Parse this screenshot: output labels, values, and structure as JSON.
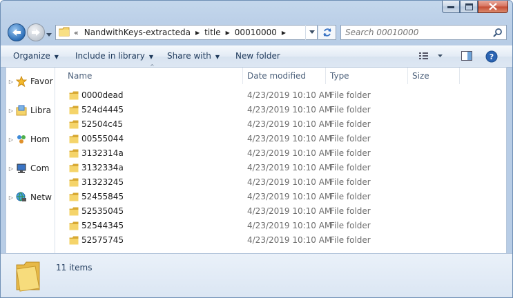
{
  "window": {
    "caption_buttons": [
      "minimize",
      "maximize",
      "close"
    ]
  },
  "address": {
    "overflow": "«",
    "crumbs": [
      "NandwithKeys-extracteda",
      "title",
      "00010000"
    ]
  },
  "search": {
    "placeholder": "Search 00010000"
  },
  "toolbar": {
    "organize": "Organize",
    "include": "Include in library",
    "share": "Share with",
    "new_folder": "New folder"
  },
  "nav": {
    "favorites": "Favor",
    "libraries": "Libra",
    "homegroup": "Hom",
    "computer": "Com",
    "network": "Netw"
  },
  "columns": {
    "name": "Name",
    "date": "Date modified",
    "type": "Type",
    "size": "Size"
  },
  "files": [
    {
      "name": "0000dead",
      "date": "4/23/2019 10:10 AM",
      "type": "File folder"
    },
    {
      "name": "524d4445",
      "date": "4/23/2019 10:10 AM",
      "type": "File folder"
    },
    {
      "name": "52504c45",
      "date": "4/23/2019 10:10 AM",
      "type": "File folder"
    },
    {
      "name": "00555044",
      "date": "4/23/2019 10:10 AM",
      "type": "File folder"
    },
    {
      "name": "3132314a",
      "date": "4/23/2019 10:10 AM",
      "type": "File folder"
    },
    {
      "name": "3132334a",
      "date": "4/23/2019 10:10 AM",
      "type": "File folder"
    },
    {
      "name": "31323245",
      "date": "4/23/2019 10:10 AM",
      "type": "File folder"
    },
    {
      "name": "52455845",
      "date": "4/23/2019 10:10 AM",
      "type": "File folder"
    },
    {
      "name": "52535045",
      "date": "4/23/2019 10:10 AM",
      "type": "File folder"
    },
    {
      "name": "52544345",
      "date": "4/23/2019 10:10 AM",
      "type": "File folder"
    },
    {
      "name": "52575745",
      "date": "4/23/2019 10:10 AM",
      "type": "File folder"
    }
  ],
  "details": {
    "count": "11 items"
  },
  "colors": {
    "folder": "#f5d46a",
    "folder_dark": "#d8a933",
    "accent": "#1e395b"
  }
}
